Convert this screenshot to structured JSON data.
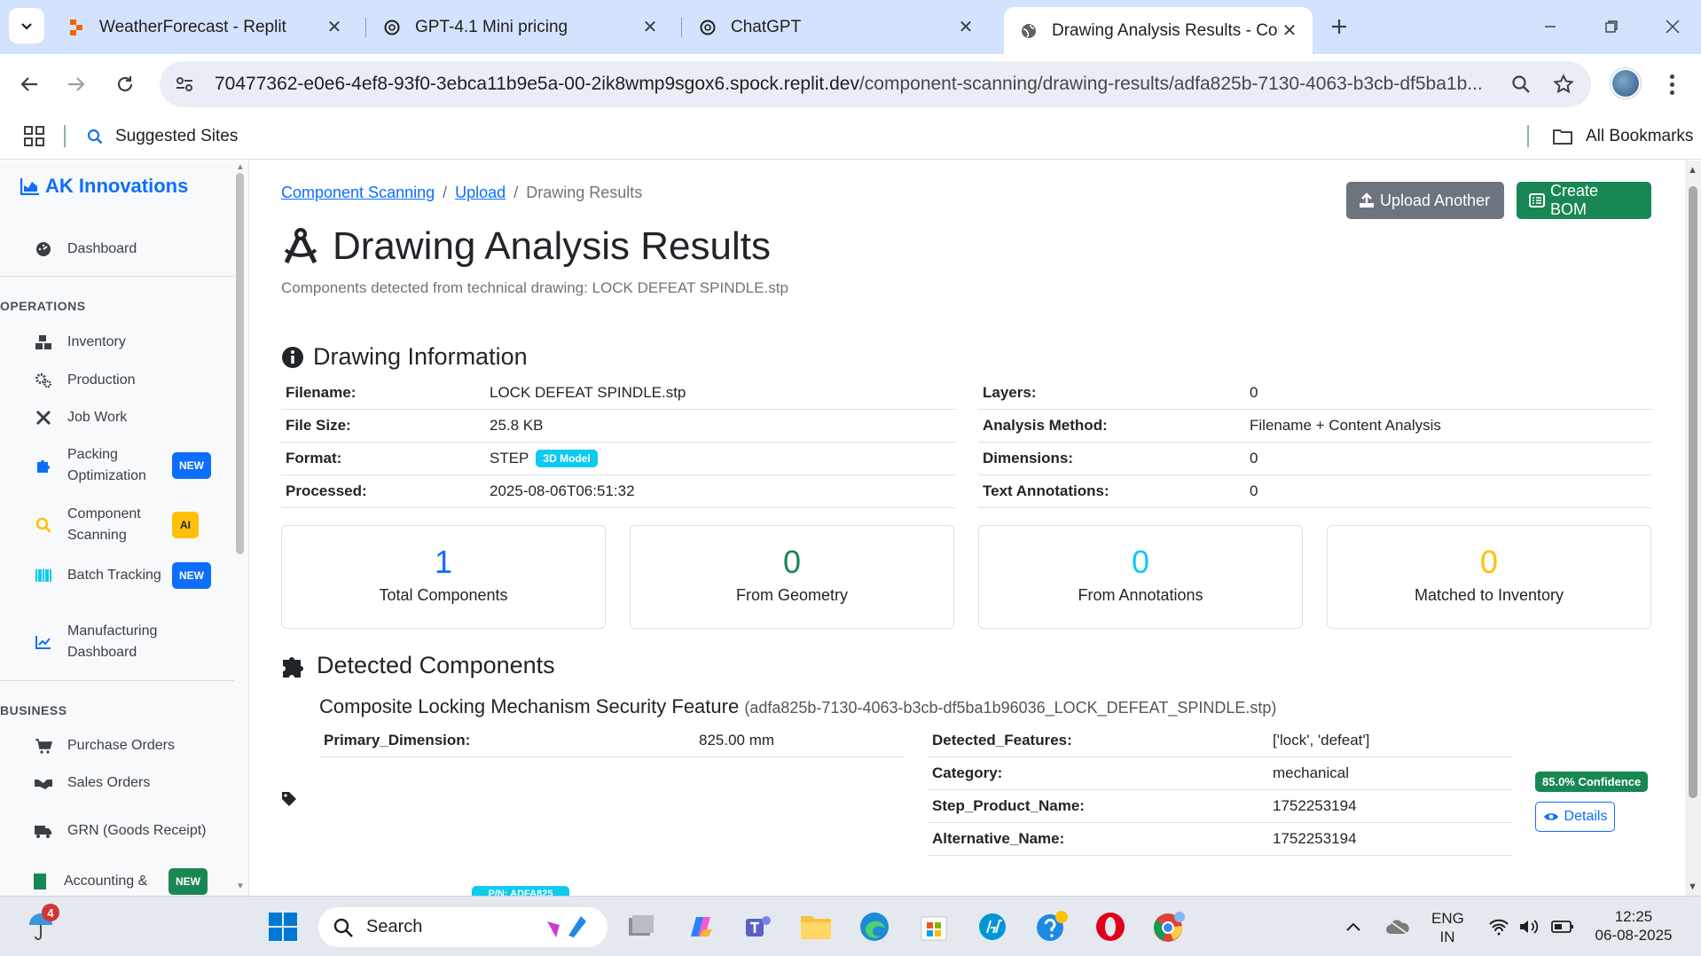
{
  "browser": {
    "tabs": [
      {
        "title": "WeatherForecast - Replit",
        "icon": "replit-icon"
      },
      {
        "title": "GPT-4.1 Mini pricing",
        "icon": "openai-icon"
      },
      {
        "title": "ChatGPT",
        "icon": "openai-icon"
      },
      {
        "title": "Drawing Analysis Results - Com",
        "icon": "globe-icon",
        "active": true
      }
    ],
    "url_host": "70477362-e0e6-4ef8-93f0-3ebca11b9e5a-00-2ik8wmp9sgox6.spock.replit.dev",
    "url_path": "/component-scanning/drawing-results/adfa825b-7130-4063-b3cb-df5ba1b...",
    "bookmarks": {
      "suggested": "Suggested Sites",
      "all": "All Bookmarks"
    }
  },
  "sidebar": {
    "brand": "AK Innovations",
    "dashboard": "Dashboard",
    "section_operations": "OPERATIONS",
    "inventory": "Inventory",
    "production": "Production",
    "job_work": "Job Work",
    "packing": "Packing Optimization",
    "scanning": "Component Scanning",
    "batch": "Batch Tracking",
    "manufacturing": "Manufacturing Dashboard",
    "section_business": "BUSINESS",
    "purchase_orders": "Purchase Orders",
    "sales_orders": "Sales Orders",
    "grn": "GRN (Goods Receipt)",
    "accounting": "Accounting &",
    "badge_new": "NEW",
    "badge_ai": "AI"
  },
  "breadcrumb": {
    "item1": "Component Scanning",
    "item2": "Upload",
    "current": "Drawing Results",
    "sep": "/"
  },
  "actions": {
    "upload_another": "Upload Another",
    "create_bom": "Create BOM"
  },
  "page": {
    "title": "Drawing Analysis Results",
    "subtitle": "Components detected from technical drawing: LOCK DEFEAT SPINDLE.stp"
  },
  "drawing_info": {
    "heading": "Drawing Information",
    "left": [
      {
        "k": "Filename:",
        "v": "LOCK DEFEAT SPINDLE.stp"
      },
      {
        "k": "File Size:",
        "v": "25.8 KB"
      },
      {
        "k": "Format:",
        "v": "STEP"
      },
      {
        "k": "Processed:",
        "v": "2025-08-06T06:51:32"
      }
    ],
    "format_badge": "3D Model",
    "right": [
      {
        "k": "Layers:",
        "v": "0"
      },
      {
        "k": "Analysis Method:",
        "v": "Filename + Content Analysis"
      },
      {
        "k": "Dimensions:",
        "v": "0"
      },
      {
        "k": "Text Annotations:",
        "v": "0"
      }
    ]
  },
  "stats": [
    {
      "value": "1",
      "label": "Total Components",
      "color": "#0d6efd"
    },
    {
      "value": "0",
      "label": "From Geometry",
      "color": "#198754"
    },
    {
      "value": "0",
      "label": "From Annotations",
      "color": "#0dcaf0"
    },
    {
      "value": "0",
      "label": "Matched to Inventory",
      "color": "#ffc107"
    }
  ],
  "detected": {
    "heading": "Detected Components",
    "component_name": "Composite Locking Mechanism Security Feature",
    "component_id": "(adfa825b-7130-4063-b3cb-df5ba1b96036_LOCK_DEFEAT_SPINDLE.stp)",
    "left_props": [
      {
        "k": "Primary_Dimension:",
        "v": "825.00 mm"
      }
    ],
    "right_props": [
      {
        "k": "Detected_Features:",
        "v": "['lock', 'defeat']"
      },
      {
        "k": "Category:",
        "v": "mechanical"
      },
      {
        "k": "Step_Product_Name:",
        "v": "1752253194"
      },
      {
        "k": "Alternative_Name:",
        "v": "1752253194"
      }
    ],
    "confidence": "85.0% Confidence",
    "details": "Details",
    "pn_badge": "P/N: ADFA825"
  },
  "taskbar": {
    "search": "Search",
    "notif_count": "4",
    "lang1": "ENG",
    "lang2": "IN",
    "time": "12:25",
    "date": "06-08-2025"
  }
}
